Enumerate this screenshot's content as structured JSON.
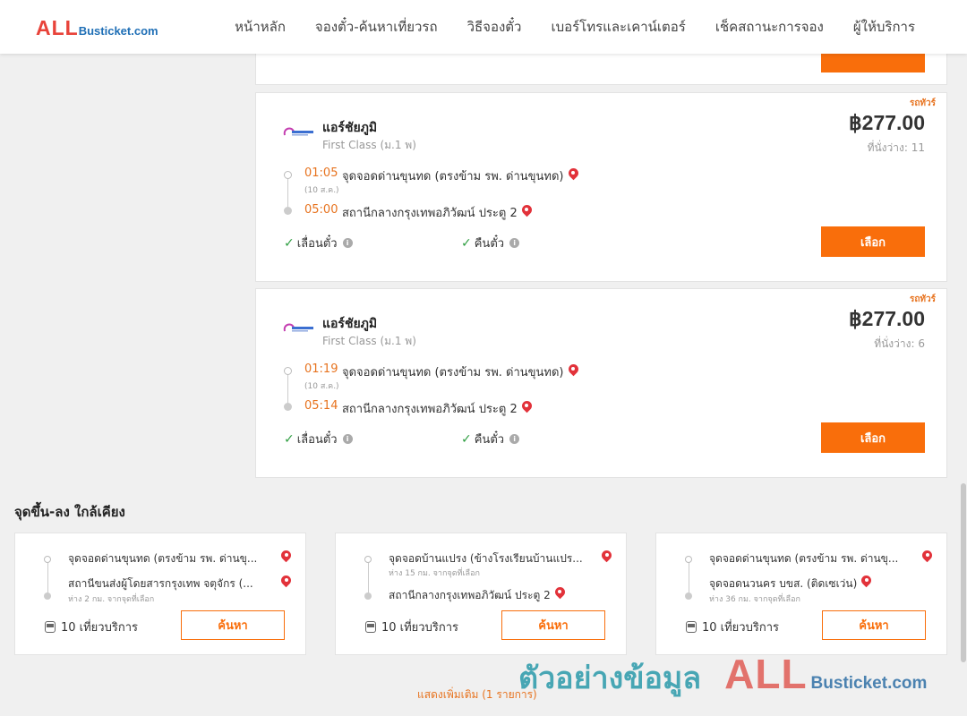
{
  "header": {
    "logo_all": "ALL",
    "logo_rest": "Busticket.com",
    "nav": [
      "หน้าหลัก",
      "จองตั๋ว-ค้นหาเที่ยวรถ",
      "วิธีจองตั๋ว",
      "เบอร์โทรและเคาน์เตอร์",
      "เช็คสถานะการจอง",
      "ผู้ให้บริการ"
    ]
  },
  "trips": [
    {
      "tag": "รถทัวร์",
      "company": "แอร์ชัยภูมิ",
      "bus_class": "First Class (ม.1 พ)",
      "price": "฿277.00",
      "seats": "ที่นั่งว่าง: 11",
      "dep_time": "01:05",
      "dep_stop": "จุดจอดด่านขุนทด (ตรงข้าม รพ. ด่านขุนทด)",
      "dep_date": "(10 ส.ค.)",
      "arr_time": "05:00",
      "arr_stop": "สถานีกลางกรุงเทพอภิวัฒน์ ประตู 2",
      "feature1": "เลื่อนตั๋ว",
      "feature2": "คืนตั๋ว",
      "button": "เลือก"
    },
    {
      "tag": "รถทัวร์",
      "company": "แอร์ชัยภูมิ",
      "bus_class": "First Class (ม.1 พ)",
      "price": "฿277.00",
      "seats": "ที่นั่งว่าง: 6",
      "dep_time": "01:19",
      "dep_stop": "จุดจอดด่านขุนทด (ตรงข้าม รพ. ด่านขุนทด)",
      "dep_date": "(10 ส.ค.)",
      "arr_time": "05:14",
      "arr_stop": "สถานีกลางกรุงเทพอภิวัฒน์ ประตู 2",
      "feature1": "เลื่อนตั๋ว",
      "feature2": "คืนตั๋ว",
      "button": "เลือก"
    }
  ],
  "nearby": {
    "title": "จุดขึ้น-ลง ใกล้เคียง",
    "cards": [
      {
        "from": "จุดจอดด่านขุนทด (ตรงข้าม รพ. ด่านขุ...",
        "from_sub": "",
        "to": "สถานีขนส่งผู้โดยสารกรุงเทพ จตุจักร (...",
        "to_sub": "ห่าง 2 กม. จากจุดที่เลือก",
        "trips": "10 เที่ยวบริการ",
        "button": "ค้นหา"
      },
      {
        "from": "จุดจอดบ้านแปรง (ข้างโรงเรียนบ้านแปร...",
        "from_sub": "ห่าง 15 กม. จากจุดที่เลือก",
        "to": "สถานีกลางกรุงเทพอภิวัฒน์ ประตู 2",
        "to_sub": "",
        "trips": "10 เที่ยวบริการ",
        "button": "ค้นหา"
      },
      {
        "from": "จุดจอดด่านขุนทด (ตรงข้าม รพ. ด่านขุ...",
        "from_sub": "",
        "to": "จุดจอดนวนคร บขส. (ติดเซเว่น)",
        "to_sub": "ห่าง 36 กม. จากจุดที่เลือก",
        "trips": "10 เที่ยวบริการ",
        "button": "ค้นหา"
      }
    ],
    "show_more": "แสดงเพิ่มเติม (1 รายการ)"
  },
  "watermark": {
    "text": "ตัวอย่างข้อมูล",
    "all": "ALL",
    "rest": "Busticket.com"
  },
  "colors": {
    "accent": "#f96e0b",
    "time": "#e7731f",
    "pin": "#e2323a",
    "check": "#2e9e41"
  }
}
